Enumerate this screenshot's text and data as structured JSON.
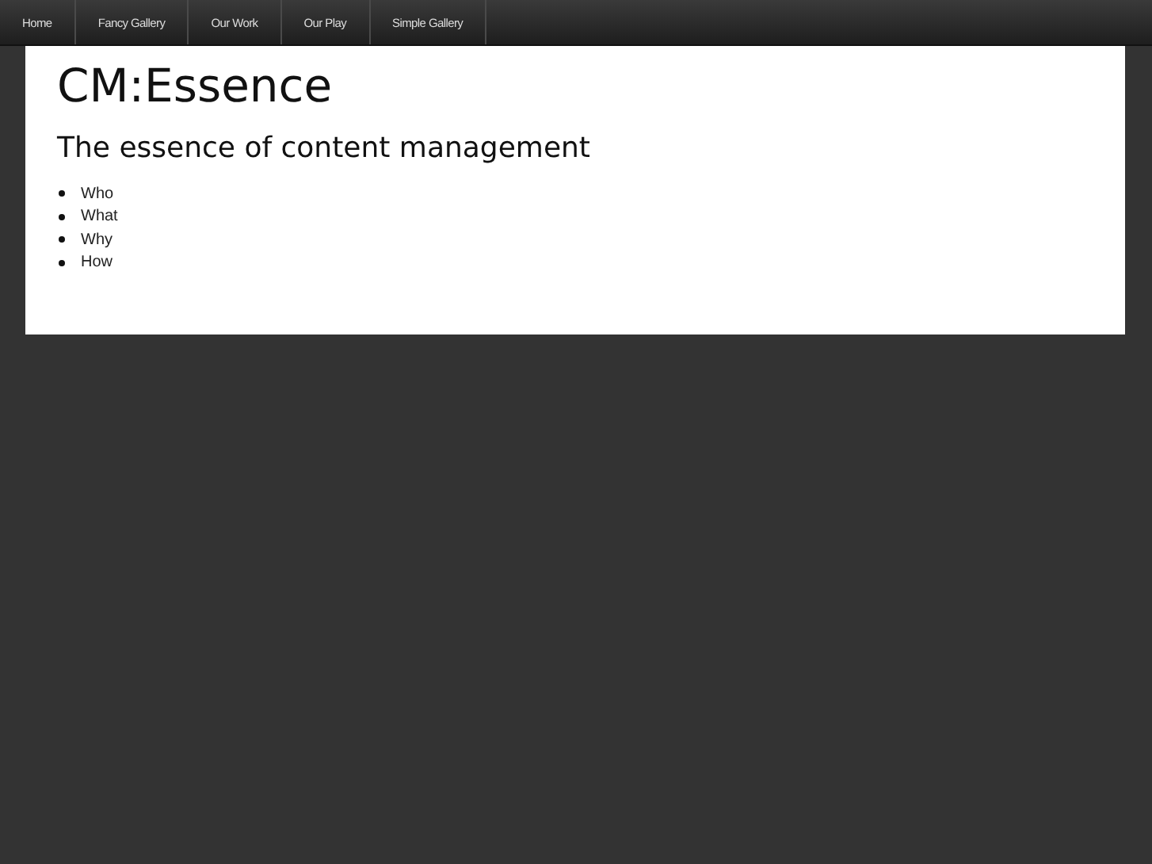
{
  "nav": [
    "Home",
    "Fancy Gallery",
    "Our Work",
    "Our Play",
    "Simple Gallery"
  ],
  "title": "CM:Essence",
  "subtitle": "The essence of content management",
  "items": [
    "Who",
    "What",
    "Why",
    "How"
  ]
}
